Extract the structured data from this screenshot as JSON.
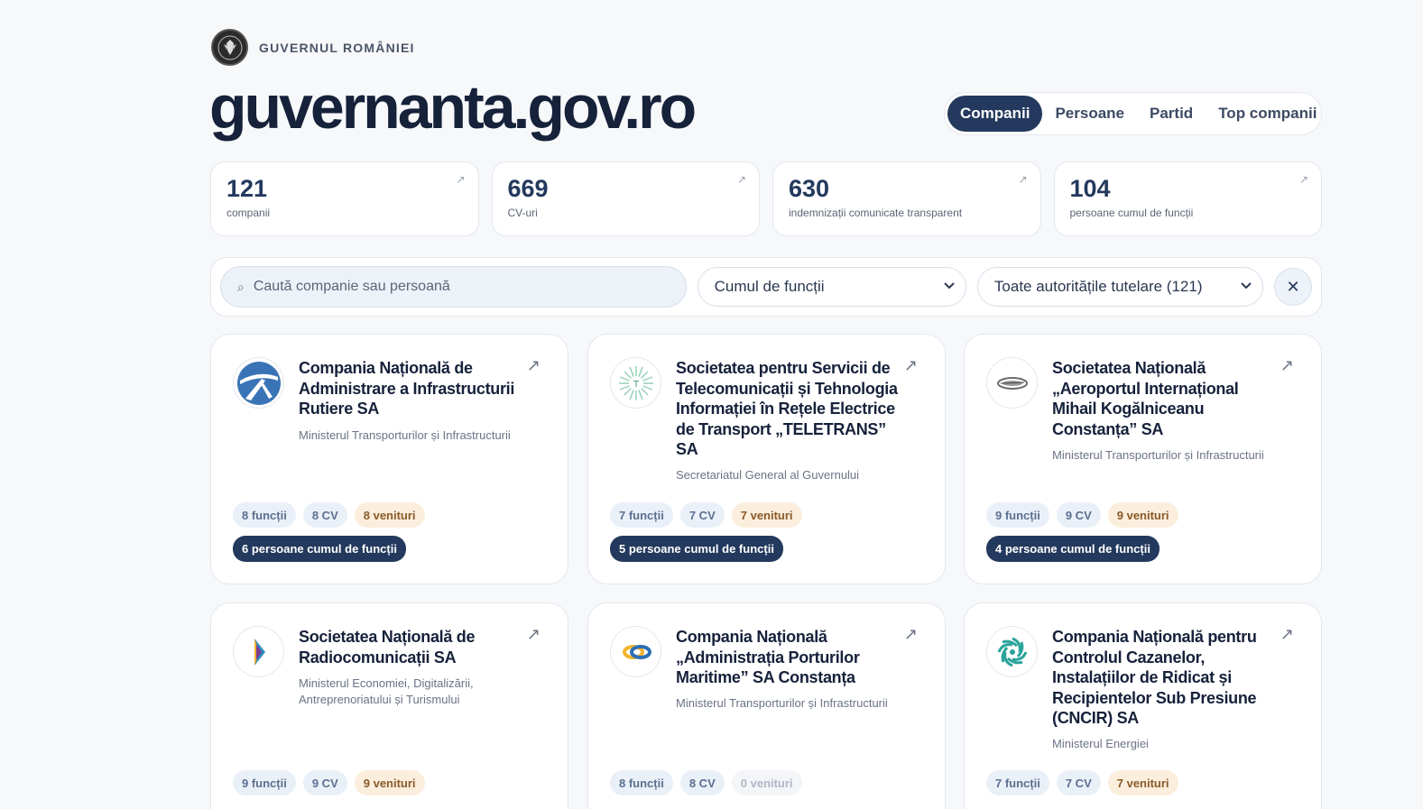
{
  "header": {
    "gov_label": "GUVERNUL ROMÂNIEI",
    "site_title": "guvernanta.gov.ro"
  },
  "nav": {
    "tabs": [
      {
        "label": "Companii",
        "active": true
      },
      {
        "label": "Persoane",
        "active": false
      },
      {
        "label": "Partid",
        "active": false
      },
      {
        "label": "Top companii",
        "active": false
      }
    ]
  },
  "stats": [
    {
      "value": "121",
      "label": "companii"
    },
    {
      "value": "669",
      "label": "CV-uri"
    },
    {
      "value": "630",
      "label": "indemnizații comunicate transparent"
    },
    {
      "value": "104",
      "label": "persoane cumul de funcții"
    }
  ],
  "filters": {
    "search_placeholder": "Caută companie sau persoană",
    "select1_value": "Cumul de funcții",
    "select2_value": "Toate autoritățile tutelare (121)",
    "clear_label": "✕"
  },
  "cards": [
    {
      "title": "Compania Națională de Administrare a Infrastructurii Rutiere SA",
      "ministry": "Ministerul Transporturilor și Infrastructurii",
      "functii": "8 funcții",
      "cv": "8 CV",
      "venituri": "8 venituri",
      "cumul": "6 persoane cumul de funcții"
    },
    {
      "title": "Societatea pentru Servicii de Telecomunicații și Tehnologia Informației în Rețele Electrice de Transport „TELETRANS” SA",
      "ministry": "Secretariatul General al Guvernului",
      "functii": "7 funcții",
      "cv": "7 CV",
      "venituri": "7 venituri",
      "cumul": "5 persoane cumul de funcții"
    },
    {
      "title": "Societatea Națională „Aeroportul Internațional Mihail Kogălniceanu Constanța” SA",
      "ministry": "Ministerul Transporturilor și Infrastructurii",
      "functii": "9 funcții",
      "cv": "9 CV",
      "venituri": "9 venituri",
      "cumul": "4 persoane cumul de funcții"
    },
    {
      "title": "Societatea Națională de Radiocomunicații SA",
      "ministry": "Ministerul Economiei, Digitalizării, Antreprenoriatului și Turismului",
      "functii": "9 funcții",
      "cv": "9 CV",
      "venituri": "9 venituri"
    },
    {
      "title": "Compania Națională „Administrația Porturilor Maritime” SA Constanța",
      "ministry": "Ministerul Transporturilor și Infrastructurii",
      "functii": "8 funcții",
      "cv": "8 CV",
      "venituri": "0 venituri"
    },
    {
      "title": "Compania Națională pentru Controlul Cazanelor, Instalațiilor de Ridicat și Recipientelor Sub Presiune (CNCIR) SA",
      "ministry": "Ministerul Energiei",
      "functii": "7 funcții",
      "cv": "7 CV",
      "venituri": "7 venituri"
    }
  ],
  "colors": {
    "accent": "#23395d",
    "pill_blue_bg": "#eaf0f8",
    "pill_orange_bg": "#fbeedd",
    "background": "#f7f8fa"
  }
}
